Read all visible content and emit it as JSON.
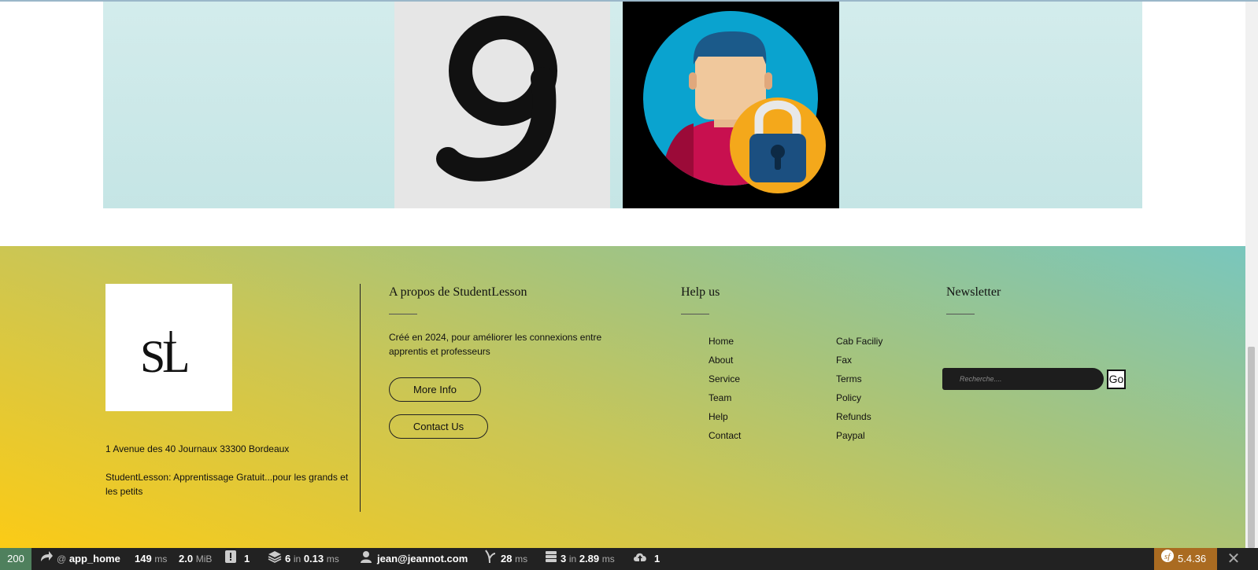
{
  "hero": {
    "image_one": "number-nine-image",
    "image_two": "user-lock-avatar-image"
  },
  "footer": {
    "logo_text": "SL",
    "address": "1 Avenue des 40 Journaux 33300 Bordeaux",
    "slogan": "StudentLesson: Apprentissage Gratuit...pour les grands et les petits",
    "about": {
      "title": "A propos de StudentLesson",
      "text": "Créé en 2024, pour améliorer les connexions entre apprentis et professeurs",
      "more_info": "More Info",
      "contact_us": "Contact Us"
    },
    "help": {
      "title": "Help us",
      "col1": [
        "Home",
        "About",
        "Service",
        "Team",
        "Help",
        "Contact"
      ],
      "col2": [
        "Cab Faciliy",
        "Fax",
        "Terms",
        "Policy",
        "Refunds",
        "Paypal"
      ]
    },
    "newsletter": {
      "title": "Newsletter",
      "placeholder": "Recherche....",
      "go_label": "Go"
    }
  },
  "toolbar": {
    "status_code": "200",
    "route_at": "@",
    "route": "app_home",
    "time_value": "149",
    "time_unit": "ms",
    "memory_value": "2.0",
    "memory_unit": "MiB",
    "logs_count": "1",
    "cache_count": "6",
    "cache_in": "in",
    "cache_time": "0.13",
    "cache_unit": "ms",
    "user": "jean@jeannot.com",
    "twig_time": "28",
    "twig_unit": "ms",
    "db_count": "3",
    "db_in": "in",
    "db_time": "2.89",
    "db_unit": "ms",
    "upload_count": "1",
    "symfony_version": "5.4.36",
    "colors": {
      "status_ok": "#4f805d",
      "version_bg": "#aa6b21",
      "bar_bg": "#222222"
    }
  }
}
